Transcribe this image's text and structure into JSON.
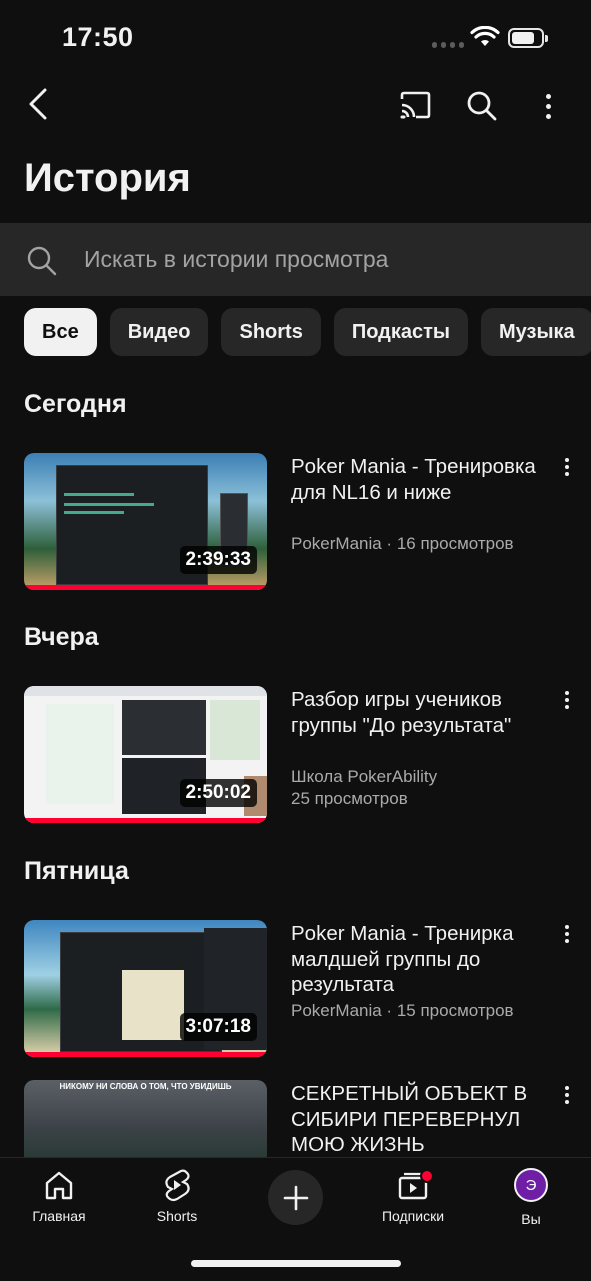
{
  "status": {
    "time": "17:50"
  },
  "header": {
    "back_icon": "back-arrow-icon",
    "cast_icon": "cast-icon",
    "search_icon": "search-icon",
    "more_icon": "more-vert-icon"
  },
  "page": {
    "title": "История"
  },
  "search": {
    "placeholder": "Искать в истории просмотра"
  },
  "chips": [
    "Все",
    "Видео",
    "Shorts",
    "Подкасты",
    "Музыка"
  ],
  "sections": [
    {
      "heading": "Сегодня",
      "videos": [
        {
          "title": "Poker Mania - Тренировка для NL16 и ниже",
          "meta": [
            "PokerMania · 16 просмотров"
          ],
          "duration": "2:39:33"
        }
      ]
    },
    {
      "heading": "Вчера",
      "videos": [
        {
          "title": "Разбор игры учеников группы \"До результата\"",
          "meta": [
            "Школа PokerAbility",
            "25 просмотров"
          ],
          "duration": "2:50:02"
        }
      ]
    },
    {
      "heading": "Пятница",
      "videos": [
        {
          "title": "Poker Mania - Тренирка малдшей группы до результата",
          "meta": [
            "PokerMania · 15 просмотров"
          ],
          "duration": "3:07:18"
        },
        {
          "title": "СЕКРЕТНЫЙ ОБЪЕКТ В СИБИРИ ПЕРЕВЕРНУЛ МОЮ ЖИЗНЬ",
          "meta": [],
          "duration": "",
          "thumb_caption": "НИКОМУ НИ СЛОВА О ТОМ, ЧТО УВИДИШЬ"
        }
      ]
    }
  ],
  "bottom_nav": {
    "home": "Главная",
    "shorts": "Shorts",
    "subscriptions": "Подписки",
    "you": "Вы",
    "avatar_letter": "Э"
  },
  "colors": {
    "background": "#0f0f0f",
    "surface": "#272727",
    "accent": "#ff0033",
    "avatar": "#6f1fa6"
  }
}
